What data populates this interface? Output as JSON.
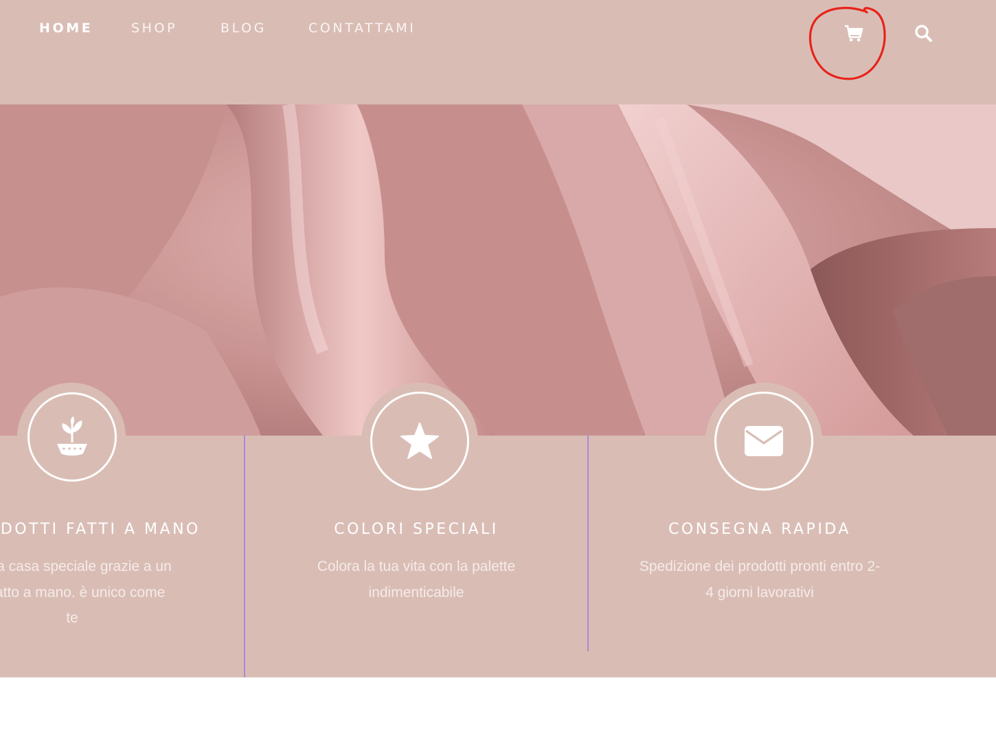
{
  "nav": {
    "items": [
      {
        "label": "HOME",
        "active": true
      },
      {
        "label": "SHOP",
        "active": false
      },
      {
        "label": "BLOG",
        "active": false
      },
      {
        "label": "CONTATTAMI",
        "active": false
      }
    ],
    "icons": {
      "cart": "shopping-cart-icon",
      "search": "search-icon"
    }
  },
  "annotation": {
    "shape": "hand-drawn circle",
    "color": "#e8231a",
    "target": "cart"
  },
  "hero": {
    "subject": "pink linen fabric photograph"
  },
  "features": [
    {
      "icon": "handmade-plant-icon",
      "title": "ODOTTI FATTI A MANO",
      "lines": [
        "a tua casa speciale grazie a un",
        "o fatto a mano. è unico come",
        "te"
      ]
    },
    {
      "icon": "star-icon",
      "title": "COLORI SPECIALI",
      "lines": [
        "Colora la tua vita con la palette",
        "indimenticabile"
      ]
    },
    {
      "icon": "envelope-icon",
      "title": "CONSEGNA RAPIDA",
      "lines": [
        "Spedizione dei prodotti pronti entro 2-",
        "4 giorni lavorativi"
      ]
    }
  ],
  "colors": {
    "brand": "#d9bdb5",
    "text": "#ffffff",
    "divider": "#a98ad6",
    "annotation": "#e8231a"
  }
}
